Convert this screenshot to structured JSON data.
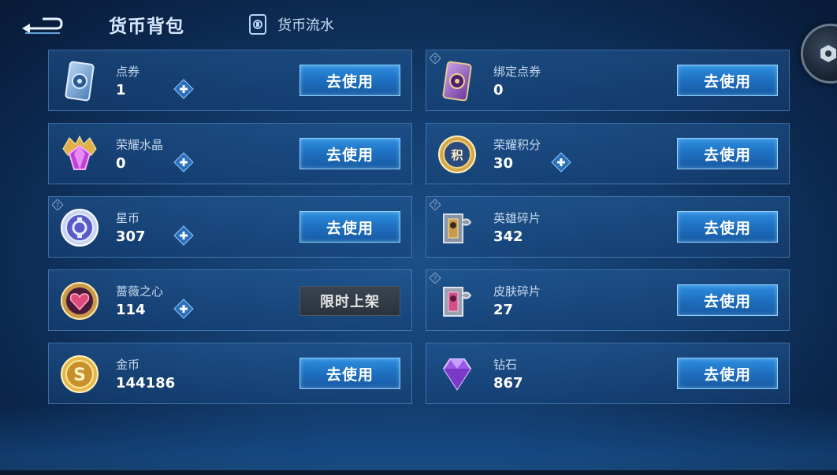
{
  "header": {
    "title": "货币背包",
    "flow_link": "货币流水"
  },
  "buttons": {
    "use": "去使用",
    "limited": "限时上架"
  },
  "currencies": [
    {
      "name": "点券",
      "amount": "1",
      "icon": "ticket-icon",
      "has_plus": true,
      "has_info": false,
      "action": "use"
    },
    {
      "name": "绑定点券",
      "amount": "0",
      "icon": "bound-ticket-icon",
      "has_plus": false,
      "has_info": true,
      "action": "use"
    },
    {
      "name": "荣耀水晶",
      "amount": "0",
      "icon": "glory-crystal-icon",
      "has_plus": true,
      "has_info": false,
      "action": "use"
    },
    {
      "name": "荣耀积分",
      "amount": "30",
      "icon": "glory-points-icon",
      "has_plus": true,
      "has_info": false,
      "action": "use"
    },
    {
      "name": "星币",
      "amount": "307",
      "icon": "star-coin-icon",
      "has_plus": true,
      "has_info": true,
      "action": "use"
    },
    {
      "name": "英雄碎片",
      "amount": "342",
      "icon": "hero-fragment-icon",
      "has_plus": false,
      "has_info": true,
      "action": "use"
    },
    {
      "name": "蔷薇之心",
      "amount": "114",
      "icon": "rose-heart-icon",
      "has_plus": true,
      "has_info": false,
      "action": "limited"
    },
    {
      "name": "皮肤碎片",
      "amount": "27",
      "icon": "skin-fragment-icon",
      "has_plus": false,
      "has_info": true,
      "action": "use"
    },
    {
      "name": "金币",
      "amount": "144186",
      "icon": "gold-coin-icon",
      "has_plus": false,
      "has_info": false,
      "action": "use"
    },
    {
      "name": "钻石",
      "amount": "867",
      "icon": "diamond-icon",
      "has_plus": false,
      "has_info": false,
      "action": "use"
    }
  ]
}
